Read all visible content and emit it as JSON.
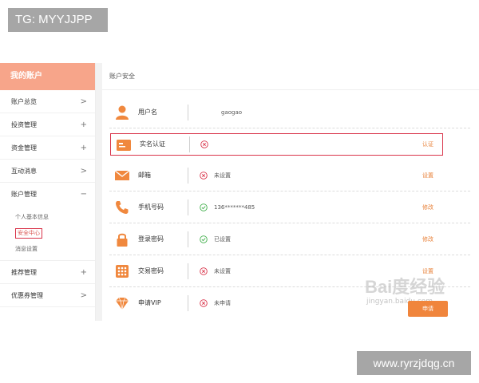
{
  "watermark_tg": "TG: MYYJJPP",
  "sidebar": {
    "header": "我的账户",
    "items": [
      {
        "label": "账户总览",
        "ctrl": ">"
      },
      {
        "label": "投资管理",
        "ctrl": "+"
      },
      {
        "label": "资金管理",
        "ctrl": "+"
      },
      {
        "label": "互动消息",
        "ctrl": ">"
      },
      {
        "label": "账户管理",
        "ctrl": "−"
      }
    ],
    "sub_items": [
      "个人基本信息",
      "安全中心",
      "消息设置"
    ],
    "items_after": [
      {
        "label": "推荐管理",
        "ctrl": "+"
      },
      {
        "label": "优惠券管理",
        "ctrl": ">"
      }
    ]
  },
  "main": {
    "title": "账户安全",
    "rows": [
      {
        "label": "用户名",
        "icon": "user-icon",
        "status": "",
        "value": "gaogao",
        "action": ""
      },
      {
        "label": "实名认证",
        "icon": "id-card-icon",
        "status": "x",
        "value": "",
        "action": "认证"
      },
      {
        "label": "邮箱",
        "icon": "mail-icon",
        "status": "x",
        "value": "未设置",
        "action": "设置"
      },
      {
        "label": "手机号码",
        "icon": "phone-icon",
        "status": "check",
        "value": "136*******485",
        "action": "修改"
      },
      {
        "label": "登录密码",
        "icon": "lock-icon",
        "status": "check",
        "value": "已设置",
        "action": "修改"
      },
      {
        "label": "交易密码",
        "icon": "keypad-icon",
        "status": "x",
        "value": "未设置",
        "action": "设置"
      },
      {
        "label": "申请VIP",
        "icon": "diamond-icon",
        "status": "x",
        "value": "未申请",
        "action": "申请"
      }
    ]
  },
  "watermark_baidu": {
    "brand": "Bai度经验",
    "url": "jingyan.baidu.com"
  },
  "watermark_site": "www.ryrzjdqg.cn",
  "colors": {
    "accent": "#f0853c",
    "header": "#f7a58a",
    "highlight": "#d9344a",
    "ok": "#3fae49",
    "bad": "#d9344a"
  }
}
